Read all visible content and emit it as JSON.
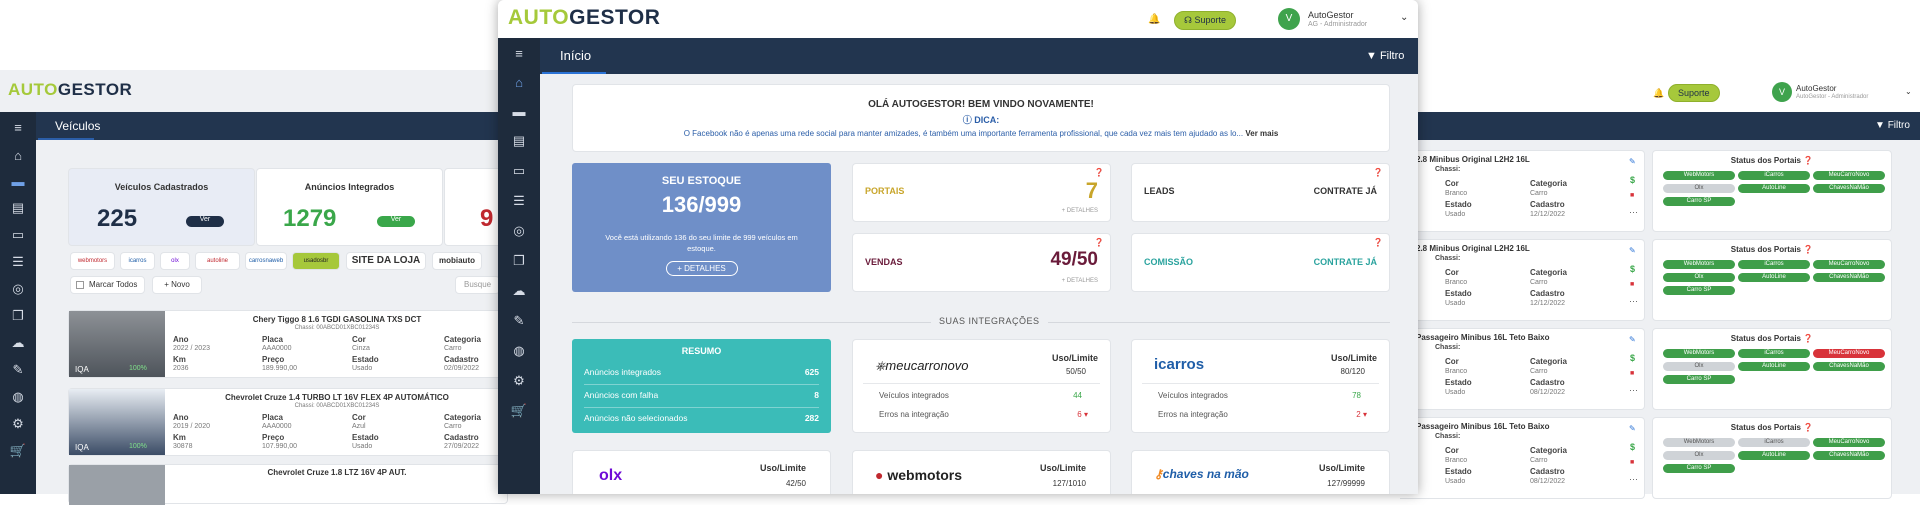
{
  "brand": {
    "auto": "AUTO",
    "gestor": "GESTOR"
  },
  "back": {
    "title": "Veículos",
    "filter": "Filtro",
    "suporte": "Suporte",
    "user": {
      "name": "AutoGestor",
      "role": "AutoGestor - Administrador",
      "initial": "V"
    },
    "stats": [
      {
        "label": "Veículos Cadastrados",
        "value": "225",
        "btn": "Ver"
      },
      {
        "label": "Anúncios Integrados",
        "value": "1279",
        "btn": "Ver"
      },
      {
        "label": "",
        "value": "9",
        "btn": ""
      }
    ],
    "portal_logos": [
      "webmotors",
      "icarros",
      "olx",
      "autoline",
      "carrosnaweb",
      "usadosbr"
    ],
    "site_label": "SITE DA LOJA",
    "mobi": "mobiauto",
    "marcar": "Marcar Todos",
    "novo": "+ Novo",
    "busca": "Busque",
    "vehicles": [
      {
        "title": "Chery Tiggo 8 1.6 TGDI GASOLINA TXS DCT",
        "chassi": "Chassi: 00ABCD01XBC01234S",
        "ano_l": "Ano",
        "ano": "2022 / 2023",
        "placa_l": "Placa",
        "placa": "AAA0000",
        "cor_l": "Cor",
        "cor": "Cinza",
        "cat_l": "Categoria",
        "cat": "Carro",
        "km_l": "Km",
        "km": "2036",
        "preco_l": "Preço",
        "preco": "189.990,00",
        "est_l": "Estado",
        "est": "Usado",
        "cad_l": "Cadastro",
        "cad": "02/09/2022",
        "iqa": "IQA",
        "pct": "100%"
      },
      {
        "title": "Chevrolet Cruze 1.4 TURBO LT 16V FLEX 4P AUTOMÁTICO",
        "chassi": "Chassi: 00ABCD01XBC01234S",
        "ano_l": "Ano",
        "ano": "2019 / 2020",
        "placa_l": "Placa",
        "placa": "AAA0000",
        "cor_l": "Cor",
        "cor": "Azul",
        "cat_l": "Categoria",
        "cat": "Carro",
        "km_l": "Km",
        "km": "30878",
        "preco_l": "Preço",
        "preco": "107.990,00",
        "est_l": "Estado",
        "est": "Usado",
        "cad_l": "Cadastro",
        "cad": "27/09/2022",
        "iqa": "IQA",
        "pct": "100%"
      },
      {
        "title": "Chevrolet Cruze 1.8 LTZ 16V 4P AUT."
      }
    ],
    "right_rows": [
      {
        "title": "2.8 Minibus Original L2H2 16L",
        "chassi": "Chassi:",
        "cor_l": "Cor",
        "cor": "Branco",
        "cat_l": "Categoria",
        "cat": "Carro",
        "est_l": "Estado",
        "est": "Usado",
        "cad_l": "Cadastro",
        "cad": "12/12/2022",
        "status": "Status dos Portais",
        "tags": [
          [
            "WebMotors",
            "g"
          ],
          [
            "iCarros",
            "g"
          ],
          [
            "MeuCarroNovo",
            "g"
          ],
          [
            "Olx",
            "gr"
          ],
          [
            "AutoLine",
            "g"
          ],
          [
            "ChavesNaMão",
            "g"
          ],
          [
            "Carro SP",
            "g"
          ]
        ]
      },
      {
        "title": "2.8 Minibus Original L2H2 16L",
        "chassi": "Chassi:",
        "cor_l": "Cor",
        "cor": "Branco",
        "cat_l": "Categoria",
        "cat": "Carro",
        "est_l": "Estado",
        "est": "Usado",
        "cad_l": "Cadastro",
        "cad": "12/12/2022",
        "status": "Status dos Portais",
        "tags": [
          [
            "WebMotors",
            "g"
          ],
          [
            "iCarros",
            "g"
          ],
          [
            "MeuCarroNovo",
            "g"
          ],
          [
            "Olx",
            "g"
          ],
          [
            "AutoLine",
            "g"
          ],
          [
            "ChavesNaMão",
            "g"
          ],
          [
            "Carro SP",
            "g"
          ]
        ]
      },
      {
        "title": "Passageiro Minibus 16L Teto Baixo",
        "chassi": "Chassi:",
        "cor_l": "Cor",
        "cor": "Branco",
        "cat_l": "Categoria",
        "cat": "Carro",
        "est_l": "Estado",
        "est": "Usado",
        "cad_l": "Cadastro",
        "cad": "08/12/2022",
        "status": "Status dos Portais",
        "tags": [
          [
            "WebMotors",
            "g"
          ],
          [
            "iCarros",
            "g"
          ],
          [
            "MeuCarroNovo",
            "r"
          ],
          [
            "Olx",
            "gr"
          ],
          [
            "AutoLine",
            "g"
          ],
          [
            "ChavesNaMão",
            "g"
          ],
          [
            "Carro SP",
            "g"
          ]
        ]
      },
      {
        "title": "Passageiro Minibus 16L Teto Baixo",
        "chassi": "Chassi:",
        "cor_l": "Cor",
        "cor": "Branco",
        "cat_l": "Categoria",
        "cat": "Carro",
        "est_l": "Estado",
        "est": "Usado",
        "cad_l": "Cadastro",
        "cad": "08/12/2022",
        "status": "Status dos Portais",
        "tags": [
          [
            "WebMotors",
            "gr"
          ],
          [
            "iCarros",
            "gr"
          ],
          [
            "MeuCarroNovo",
            "g"
          ],
          [
            "Olx",
            "gr"
          ],
          [
            "AutoLine",
            "g"
          ],
          [
            "ChavesNaMão",
            "g"
          ],
          [
            "Carro SP",
            "g"
          ]
        ]
      }
    ]
  },
  "front": {
    "title": "Início",
    "filter": "Filtro",
    "suporte": "Suporte",
    "user": {
      "name": "AutoGestor",
      "role": "AG - Administrador",
      "initial": "V"
    },
    "welcome": "OLÁ AUTOGESTOR! BEM VINDO NOVAMENTE!",
    "dica": "DICA:",
    "dica_text": "O Facebook não é apenas uma rede social para manter amizades, é também uma importante ferramenta profissional, que cada vez mais tem ajudado as lo...",
    "ver_mais": "Ver mais",
    "estoque": {
      "title": "SEU ESTOQUE",
      "value": "136/999",
      "text": "Você está utilizando 136 do seu limite de 999 veículos em estoque.",
      "btn": "+ DETALHES"
    },
    "portais": {
      "label": "PORTAIS",
      "value": "7",
      "det": "+ DETALHES"
    },
    "leads": {
      "label": "LEADS",
      "action": "CONTRATE JÁ"
    },
    "vendas": {
      "label": "VENDAS",
      "value": "49/50",
      "det": "+ DETALHES"
    },
    "comissao": {
      "label": "COMISSÃO",
      "action": "CONTRATE JÁ"
    },
    "integ_title": "SUAS INTEGRAÇÕES",
    "resumo": {
      "title": "RESUMO",
      "rows": [
        {
          "label": "Anúncios integrados",
          "value": "625"
        },
        {
          "label": "Anúncios com falha",
          "value": "8"
        },
        {
          "label": "Anúncios não selecionados",
          "value": "282"
        }
      ]
    },
    "portals": [
      {
        "name": "meucarronovo",
        "uso": "Uso/Limite",
        "limit": "50/50",
        "int_l": "Veículos integrados",
        "int": "44",
        "err_l": "Erros na integração",
        "err": "6"
      },
      {
        "name": "icarros",
        "uso": "Uso/Limite",
        "limit": "80/120",
        "int_l": "Veículos integrados",
        "int": "78",
        "err_l": "Erros na integração",
        "err": "2"
      },
      {
        "name": "olx",
        "uso": "Uso/Limite",
        "limit": "42/50"
      },
      {
        "name": "webmotors",
        "uso": "Uso/Limite",
        "limit": "127/1010"
      },
      {
        "name": "chaves na mão",
        "uso": "Uso/Limite",
        "limit": "127/99999"
      }
    ]
  },
  "colors": {
    "navy": "#22354f",
    "green": "#a6c83b",
    "blue_card": "#6f8fc8",
    "teal": "#3bbcb8",
    "gold": "#c8a52a",
    "maroon": "#6a1b3a"
  }
}
